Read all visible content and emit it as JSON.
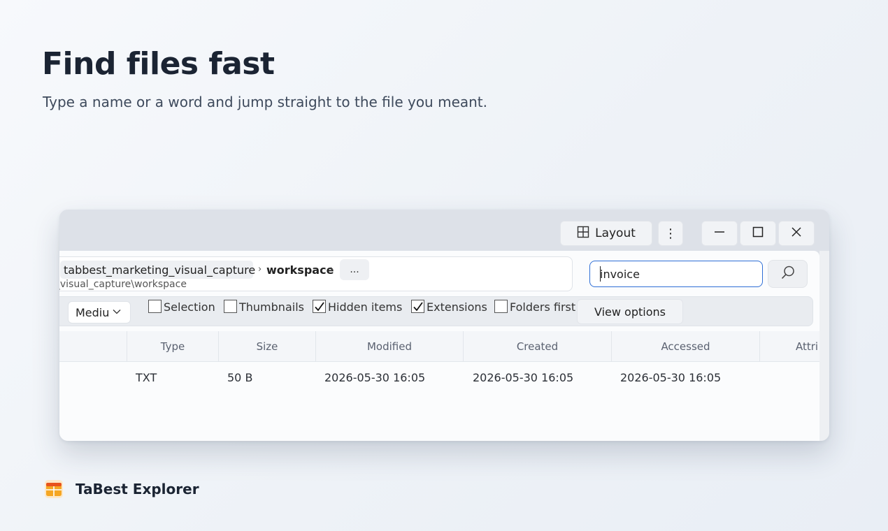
{
  "hero": {
    "title": "Find files fast",
    "subtitle": "Type a name or a word and jump straight to the file you meant."
  },
  "window": {
    "titlebar": {
      "layout_label": "Layout",
      "more_icon": "more-vertical-icon",
      "minimize_icon": "minimize-icon",
      "maximize_icon": "maximize-icon",
      "close_icon": "close-icon"
    },
    "address": {
      "crumbs": [
        "tabbest_marketing_visual_capture",
        "workspace"
      ],
      "overflow_label": "...",
      "path_text": "g_visual_capture\\workspace"
    },
    "search": {
      "value": "invoice",
      "button_icon": "search-icon"
    },
    "options": {
      "size_select": "Medium",
      "checkboxes": [
        {
          "label": "Selection",
          "checked": false
        },
        {
          "label": "Thumbnails",
          "checked": false
        },
        {
          "label": "Hidden items",
          "checked": true
        },
        {
          "label": "Extensions",
          "checked": true
        },
        {
          "label": "Folders first",
          "checked": false
        }
      ],
      "view_options_label": "View options"
    },
    "table": {
      "columns": [
        "Type",
        "Size",
        "Modified",
        "Created",
        "Accessed",
        "Attri"
      ],
      "rows": [
        {
          "type": "TXT",
          "size": "50 B",
          "modified": "2026-05-30 16:05",
          "created": "2026-05-30 16:05",
          "accessed": "2026-05-30 16:05"
        }
      ]
    }
  },
  "brand": {
    "name": "TaBest Explorer",
    "logo_colors": [
      "#f5a623",
      "#e8521c"
    ]
  }
}
